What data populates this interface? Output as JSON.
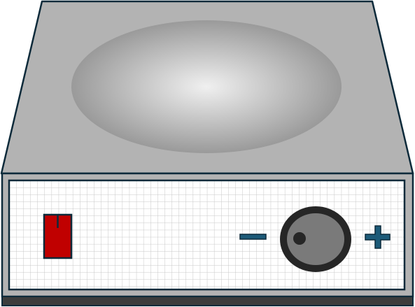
{
  "device": {
    "kind": "hot-plate-stirrer",
    "top_plate": {
      "icon": "heating-plate"
    },
    "front_panel": {
      "pattern": "grid",
      "power_switch": {
        "icon": "power-switch-icon",
        "color": "#c00000",
        "state": "off"
      },
      "control_knob": {
        "icon": "knob-icon",
        "decrease_symbol": "−",
        "increase_symbol": "+"
      }
    }
  },
  "colors": {
    "outline": "#0d2a3a",
    "casing": "#b3b3b3",
    "plate_center": "#f0f0f0",
    "plate_edge": "#9a9a9a",
    "panel_bg": "#ffffff",
    "grid_line": "#c8c8c8",
    "base_strip": "#3c3c3c",
    "switch": "#c00000",
    "knob_ring": "#262626",
    "knob_face": "#7a7a7a",
    "symbol": "#1c5a78"
  }
}
